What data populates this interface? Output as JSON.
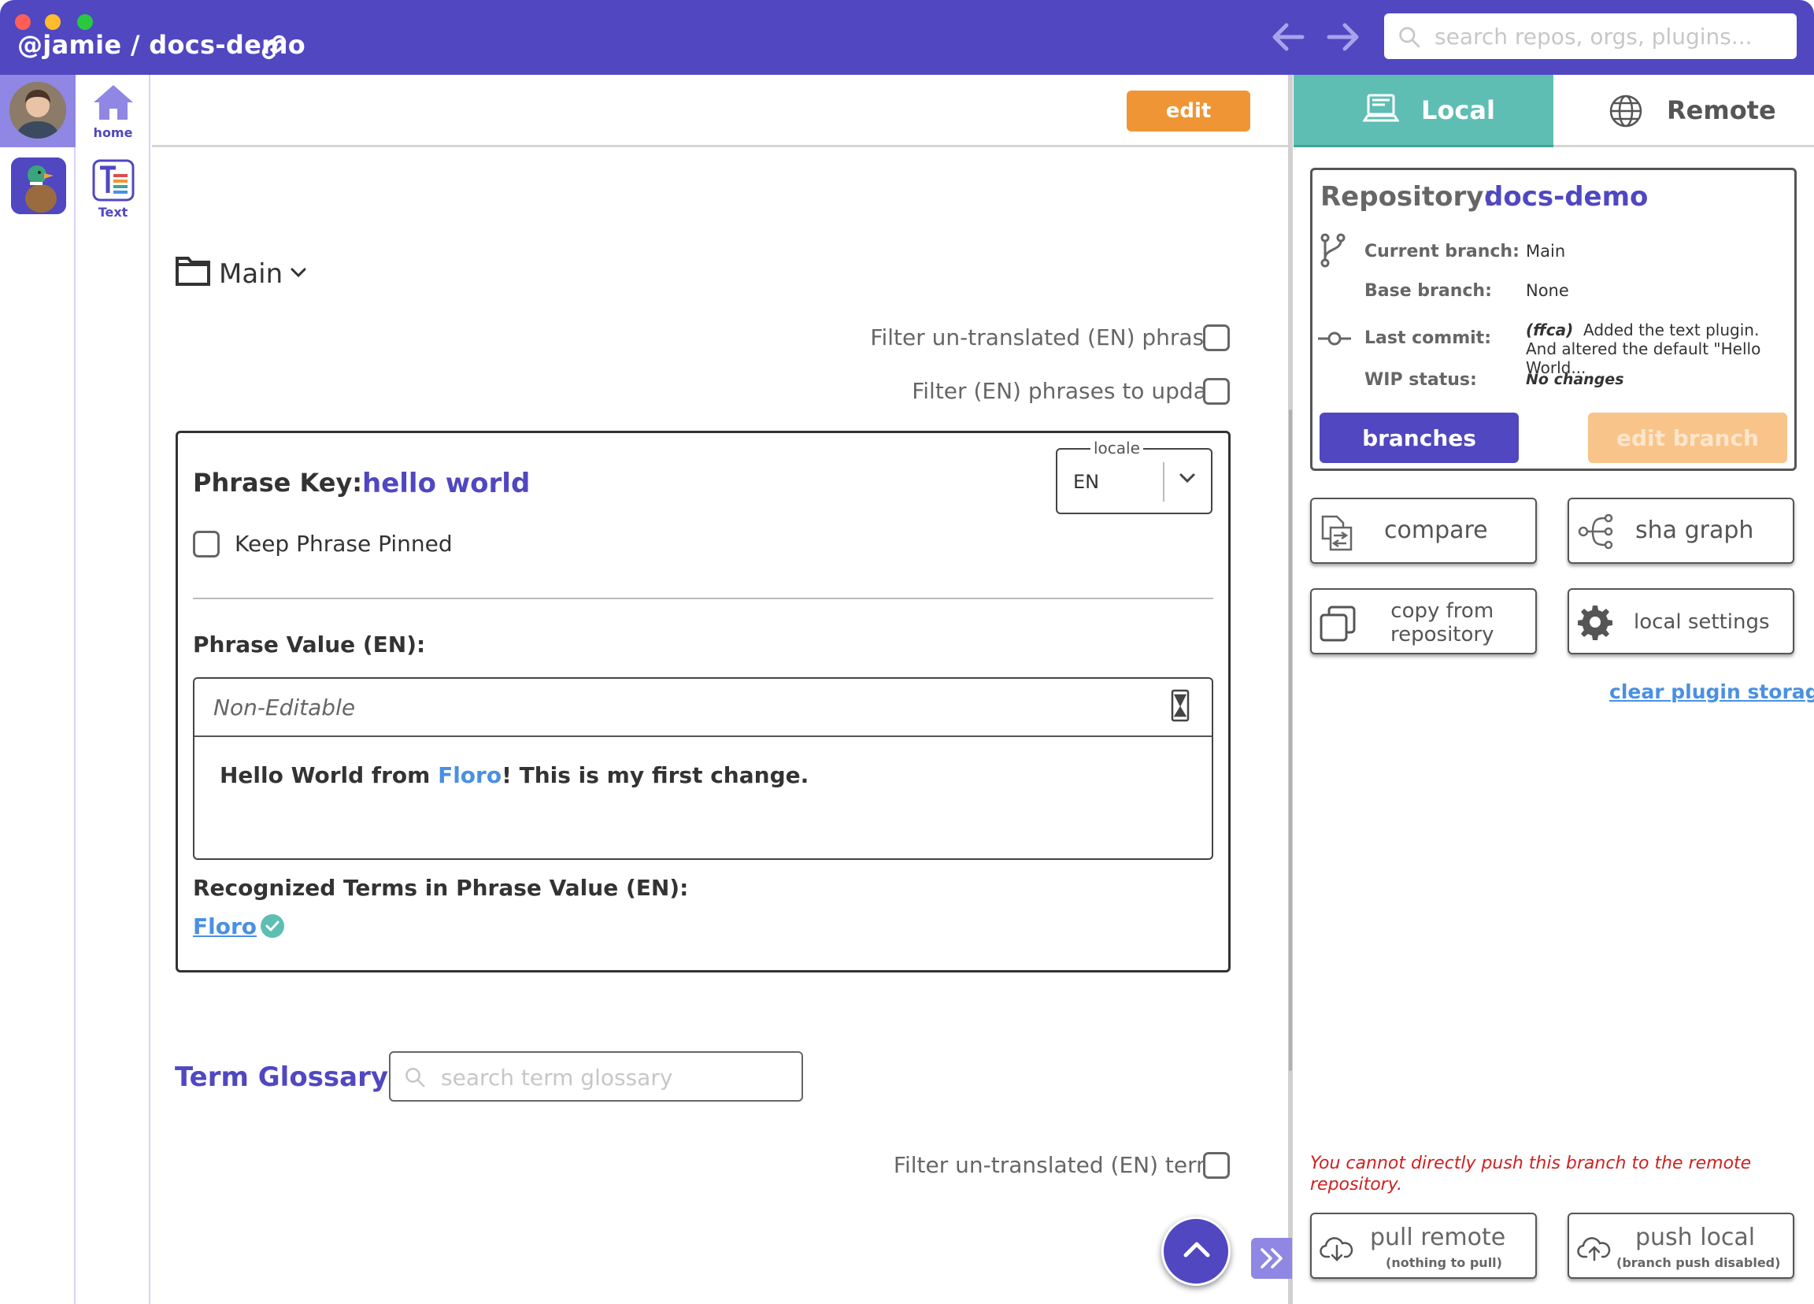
{
  "titlebar": {
    "repo_path": "@jamie / docs-demo",
    "search_placeholder": "search repos, orgs, plugins...",
    "colors": {
      "bar": "#5047c1",
      "close": "#ff5f57",
      "minimize": "#febc2e",
      "maximize": "#28c840"
    }
  },
  "rail": {
    "home_label": "home",
    "text_plugin_label": "Text"
  },
  "main": {
    "edit_label": "edit",
    "branch_name": "Main",
    "filters": {
      "untranslated_phrases": "Filter un-translated (EN) phrases",
      "phrases_to_update": "Filter (EN) phrases to update",
      "untranslated_terms": "Filter un-translated (EN) terms"
    },
    "phrase": {
      "key_label": "Phrase Key:",
      "key_value": "hello world",
      "locale_legend": "locale",
      "locale_value": "EN",
      "keep_pinned_label": "Keep Phrase Pinned",
      "value_label": "Phrase Value (EN):",
      "editor_mode": "Non-Editable",
      "value_before": "Hello World from ",
      "value_term": "Floro",
      "value_after": "! This is my first change.",
      "recognized_label": "Recognized Terms in Phrase Value (EN):",
      "recognized_term": "Floro"
    },
    "glossary": {
      "title": "Term Glossary",
      "search_placeholder": "search term glossary"
    }
  },
  "right_panel": {
    "tabs": {
      "local": "Local",
      "remote": "Remote"
    },
    "repository_label": "Repository:",
    "repository_name": "docs-demo",
    "current_branch_label": "Current branch:",
    "current_branch_value": "Main",
    "base_branch_label": "Base branch:",
    "base_branch_value": "None",
    "last_commit_label": "Last commit:",
    "last_commit_sha": "(ffca)",
    "last_commit_message": "Added the text plugin. And altered the default \"Hello World...",
    "wip_label": "WIP status:",
    "wip_value": "No changes",
    "branches_label": "branches",
    "edit_branch_label": "edit branch",
    "compare_label": "compare",
    "sha_graph_label": "sha graph",
    "copy_from_repo_line1": "copy from",
    "copy_from_repo_line2": "repository",
    "local_settings_label": "local settings",
    "clear_storage_label": "clear plugin storage",
    "push_warning": "You cannot directly push this branch to the remote repository.",
    "pull_remote_label": "pull remote",
    "pull_remote_sub": "(nothing to pull)",
    "push_local_label": "push local",
    "push_local_sub": "(branch push disabled)",
    "accent_local": "#5ebeb3"
  }
}
